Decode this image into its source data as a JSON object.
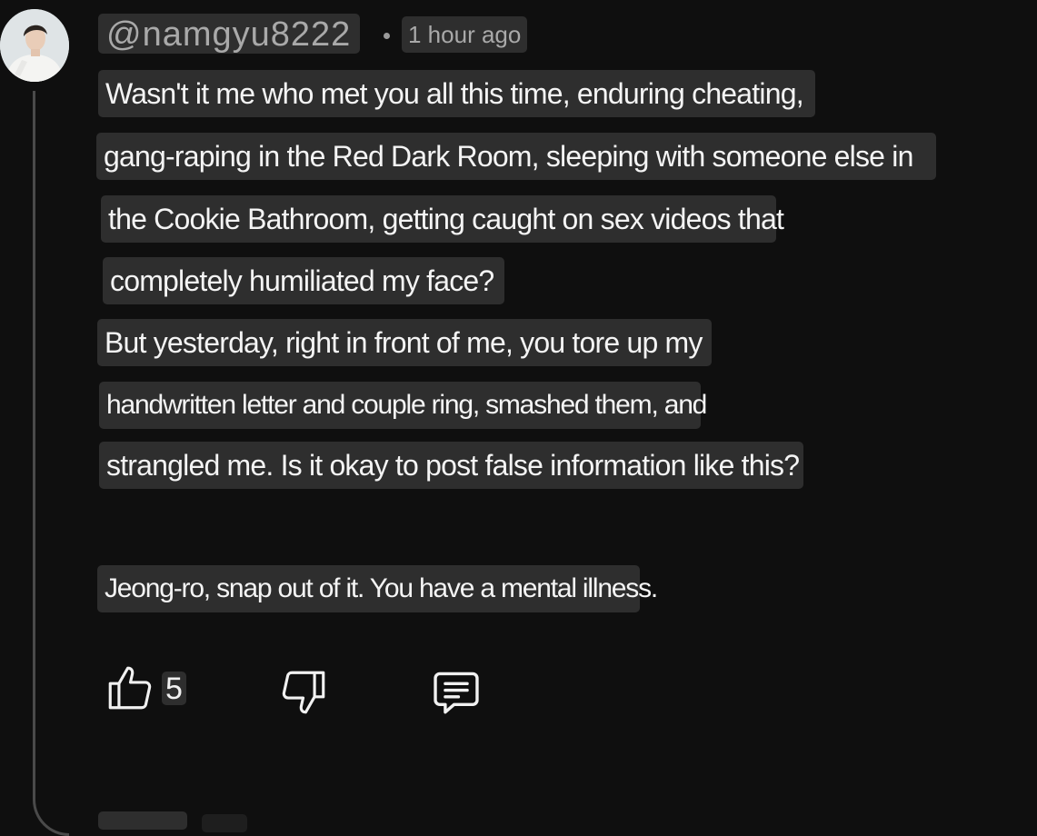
{
  "comment": {
    "author": "@namgyu8222",
    "separator": "•",
    "timestamp": "1 hour ago",
    "lines": [
      "Wasn't it me who met you all this time, enduring cheating,",
      "gang-raping in the Red Dark Room, sleeping with someone else in",
      "the Cookie Bathroom, getting caught on sex videos that",
      "completely humiliated my face?",
      "But yesterday, right in front of me, you tore up my",
      "handwritten letter and couple ring, smashed them, and",
      "strangled me. Is it okay to post false information like this?",
      "Jeong-ro, snap out of it. You have a mental illness."
    ],
    "like_count": "5"
  },
  "icons": {
    "like": "thumbs-up-icon",
    "dislike": "thumbs-down-icon",
    "reply": "comment-icon"
  },
  "colors": {
    "background": "#0f0f0f",
    "pill": "#2e2e2e",
    "text": "#f1f1f1",
    "muted_text": "#a9a9a9",
    "thread_line": "#4a4a4a"
  }
}
